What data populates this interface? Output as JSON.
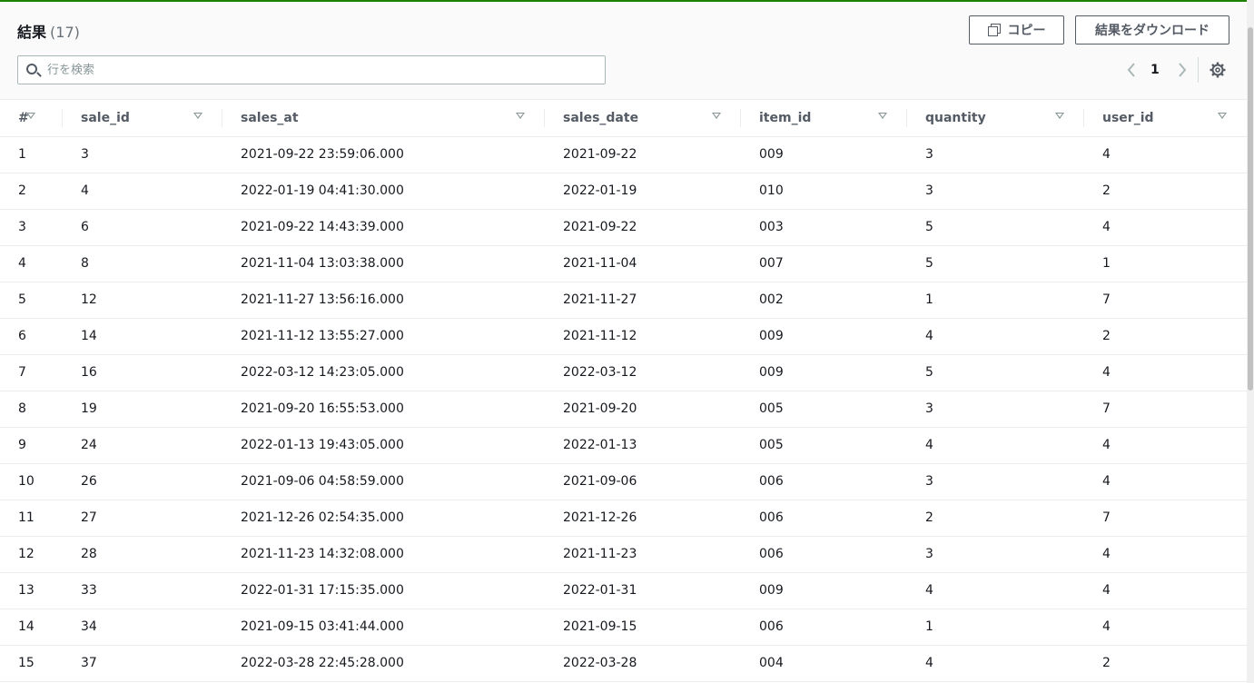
{
  "header": {
    "title": "結果",
    "count": "(17)",
    "copy_label": "コピー",
    "download_label": "結果をダウンロード"
  },
  "search": {
    "placeholder": "行を検索"
  },
  "pagination": {
    "prev": "‹",
    "current_page": "1",
    "next": "›"
  },
  "table": {
    "columns": [
      "#",
      "sale_id",
      "sales_at",
      "sales_date",
      "item_id",
      "quantity",
      "user_id"
    ],
    "rows": [
      [
        "1",
        "3",
        "2021-09-22 23:59:06.000",
        "2021-09-22",
        "009",
        "3",
        "4"
      ],
      [
        "2",
        "4",
        "2022-01-19 04:41:30.000",
        "2022-01-19",
        "010",
        "3",
        "2"
      ],
      [
        "3",
        "6",
        "2021-09-22 14:43:39.000",
        "2021-09-22",
        "003",
        "5",
        "4"
      ],
      [
        "4",
        "8",
        "2021-11-04 13:03:38.000",
        "2021-11-04",
        "007",
        "5",
        "1"
      ],
      [
        "5",
        "12",
        "2021-11-27 13:56:16.000",
        "2021-11-27",
        "002",
        "1",
        "7"
      ],
      [
        "6",
        "14",
        "2021-11-12 13:55:27.000",
        "2021-11-12",
        "009",
        "4",
        "2"
      ],
      [
        "7",
        "16",
        "2022-03-12 14:23:05.000",
        "2022-03-12",
        "009",
        "5",
        "4"
      ],
      [
        "8",
        "19",
        "2021-09-20 16:55:53.000",
        "2021-09-20",
        "005",
        "3",
        "7"
      ],
      [
        "9",
        "24",
        "2022-01-13 19:43:05.000",
        "2022-01-13",
        "005",
        "4",
        "4"
      ],
      [
        "10",
        "26",
        "2021-09-06 04:58:59.000",
        "2021-09-06",
        "006",
        "3",
        "4"
      ],
      [
        "11",
        "27",
        "2021-12-26 02:54:35.000",
        "2021-12-26",
        "006",
        "2",
        "7"
      ],
      [
        "12",
        "28",
        "2021-11-23 14:32:08.000",
        "2021-11-23",
        "006",
        "3",
        "4"
      ],
      [
        "13",
        "33",
        "2022-01-31 17:15:35.000",
        "2022-01-31",
        "009",
        "4",
        "4"
      ],
      [
        "14",
        "34",
        "2021-09-15 03:41:44.000",
        "2021-09-15",
        "006",
        "1",
        "4"
      ],
      [
        "15",
        "37",
        "2022-03-28 22:45:28.000",
        "2022-03-28",
        "004",
        "4",
        "2"
      ]
    ]
  },
  "colors": {
    "accent_line": "#1d8102",
    "border": "#eaeded"
  }
}
